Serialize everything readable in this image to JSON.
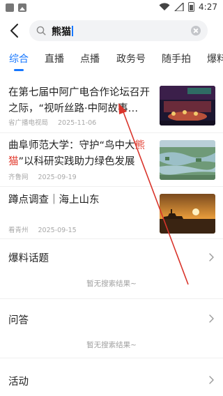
{
  "status_bar": {
    "time": "4:27"
  },
  "search": {
    "query": "熊猫"
  },
  "tabs": [
    {
      "label": "综合",
      "active": true
    },
    {
      "label": "直播",
      "active": false
    },
    {
      "label": "点播",
      "active": false
    },
    {
      "label": "政务号",
      "active": false
    },
    {
      "label": "随手拍",
      "active": false
    },
    {
      "label": "爆料",
      "active": false
    }
  ],
  "results": [
    {
      "title_parts": [
        "在第七届中阿广电合作论坛召开之际，“视听丝路·中阿故事…"
      ],
      "source": "省广播电视局",
      "date": "2025-11-06"
    },
    {
      "title_parts": [
        "曲阜师范大学：守护“鸟中大",
        "熊猫",
        "”以科研实践助力绿色发展"
      ],
      "source": "齐鲁网",
      "date": "2025-09-19"
    },
    {
      "title_parts": [
        "蹲点调查｜海上山东"
      ],
      "source": "看青州",
      "date": "2025-09-15"
    }
  ],
  "sections": [
    {
      "title": "爆料话题",
      "empty_text": "暂无搜索结果~"
    },
    {
      "title": "问答",
      "empty_text": "暂无搜索结果~"
    },
    {
      "title": "活动"
    }
  ],
  "colors": {
    "accent": "#1677ff",
    "highlight": "#e23b2e",
    "annotation_arrow": "#d9342b"
  },
  "icons": {
    "back": "chevron-left-icon",
    "search": "search-icon",
    "clear": "clear-icon",
    "section_more": "chevron-right-icon"
  }
}
